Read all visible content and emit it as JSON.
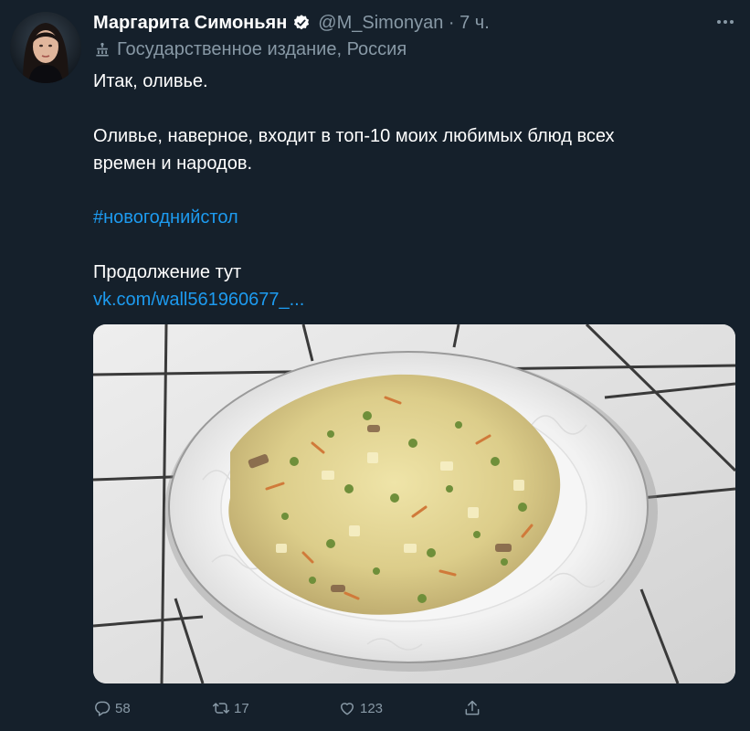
{
  "author": {
    "name": "Маргарита Симоньян",
    "handle_time": "@M_Simonyan · 7 ч.",
    "label": "Государственное издание, Россия"
  },
  "tweet": {
    "line1": "Итак, оливье.",
    "line2": "Оливье, наверное, входит в топ-10 моих любимых блюд всех",
    "line3": "времен и народов.",
    "hashtag": "#новогоднийстол",
    "line4": "Продолжение тут",
    "link": "vk.com/wall561960677_..."
  },
  "stats": {
    "replies": "58",
    "retweets": "17",
    "likes": "123"
  },
  "icons": {
    "verified": "verified-badge-icon",
    "state_media": "state-media-icon",
    "reply": "reply-icon",
    "retweet": "retweet-icon",
    "like": "heart-icon",
    "share": "share-icon",
    "more": "more-options-icon"
  },
  "colors": {
    "background": "#15202b",
    "secondary_text": "#8899a6",
    "link": "#1d9bf0"
  }
}
